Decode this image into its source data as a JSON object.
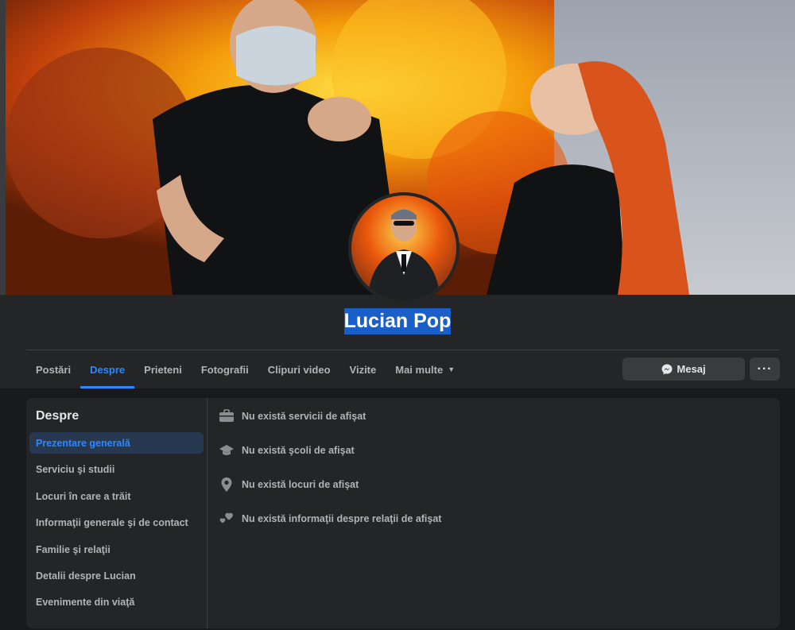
{
  "profile": {
    "name": "Lucian Pop"
  },
  "tabs": [
    {
      "label": "Postări"
    },
    {
      "label": "Despre"
    },
    {
      "label": "Prieteni"
    },
    {
      "label": "Fotografii"
    },
    {
      "label": "Clipuri video"
    },
    {
      "label": "Vizite"
    },
    {
      "label": "Mai multe"
    }
  ],
  "actions": {
    "message_label": "Mesaj",
    "more_label": "···"
  },
  "about": {
    "title": "Despre",
    "menu": [
      {
        "label": "Prezentare generală"
      },
      {
        "label": "Serviciu şi studii"
      },
      {
        "label": "Locuri în care a trăit"
      },
      {
        "label": "Informaţii generale şi de contact"
      },
      {
        "label": "Familie şi relaţii"
      },
      {
        "label": "Detalii despre Lucian"
      },
      {
        "label": "Evenimente din viaţă"
      }
    ],
    "rows": [
      {
        "icon": "briefcase-icon",
        "text": "Nu există servicii de afişat"
      },
      {
        "icon": "graduation-cap-icon",
        "text": "Nu există şcoli de afişat"
      },
      {
        "icon": "location-pin-icon",
        "text": "Nu există locuri de afişat"
      },
      {
        "icon": "hearts-icon",
        "text": "Nu există informaţii despre relaţii de afişat"
      }
    ]
  },
  "colors": {
    "accent": "#2d88ff",
    "background": "#18191a",
    "surface": "#242526",
    "selection": "#1a5fc8"
  }
}
